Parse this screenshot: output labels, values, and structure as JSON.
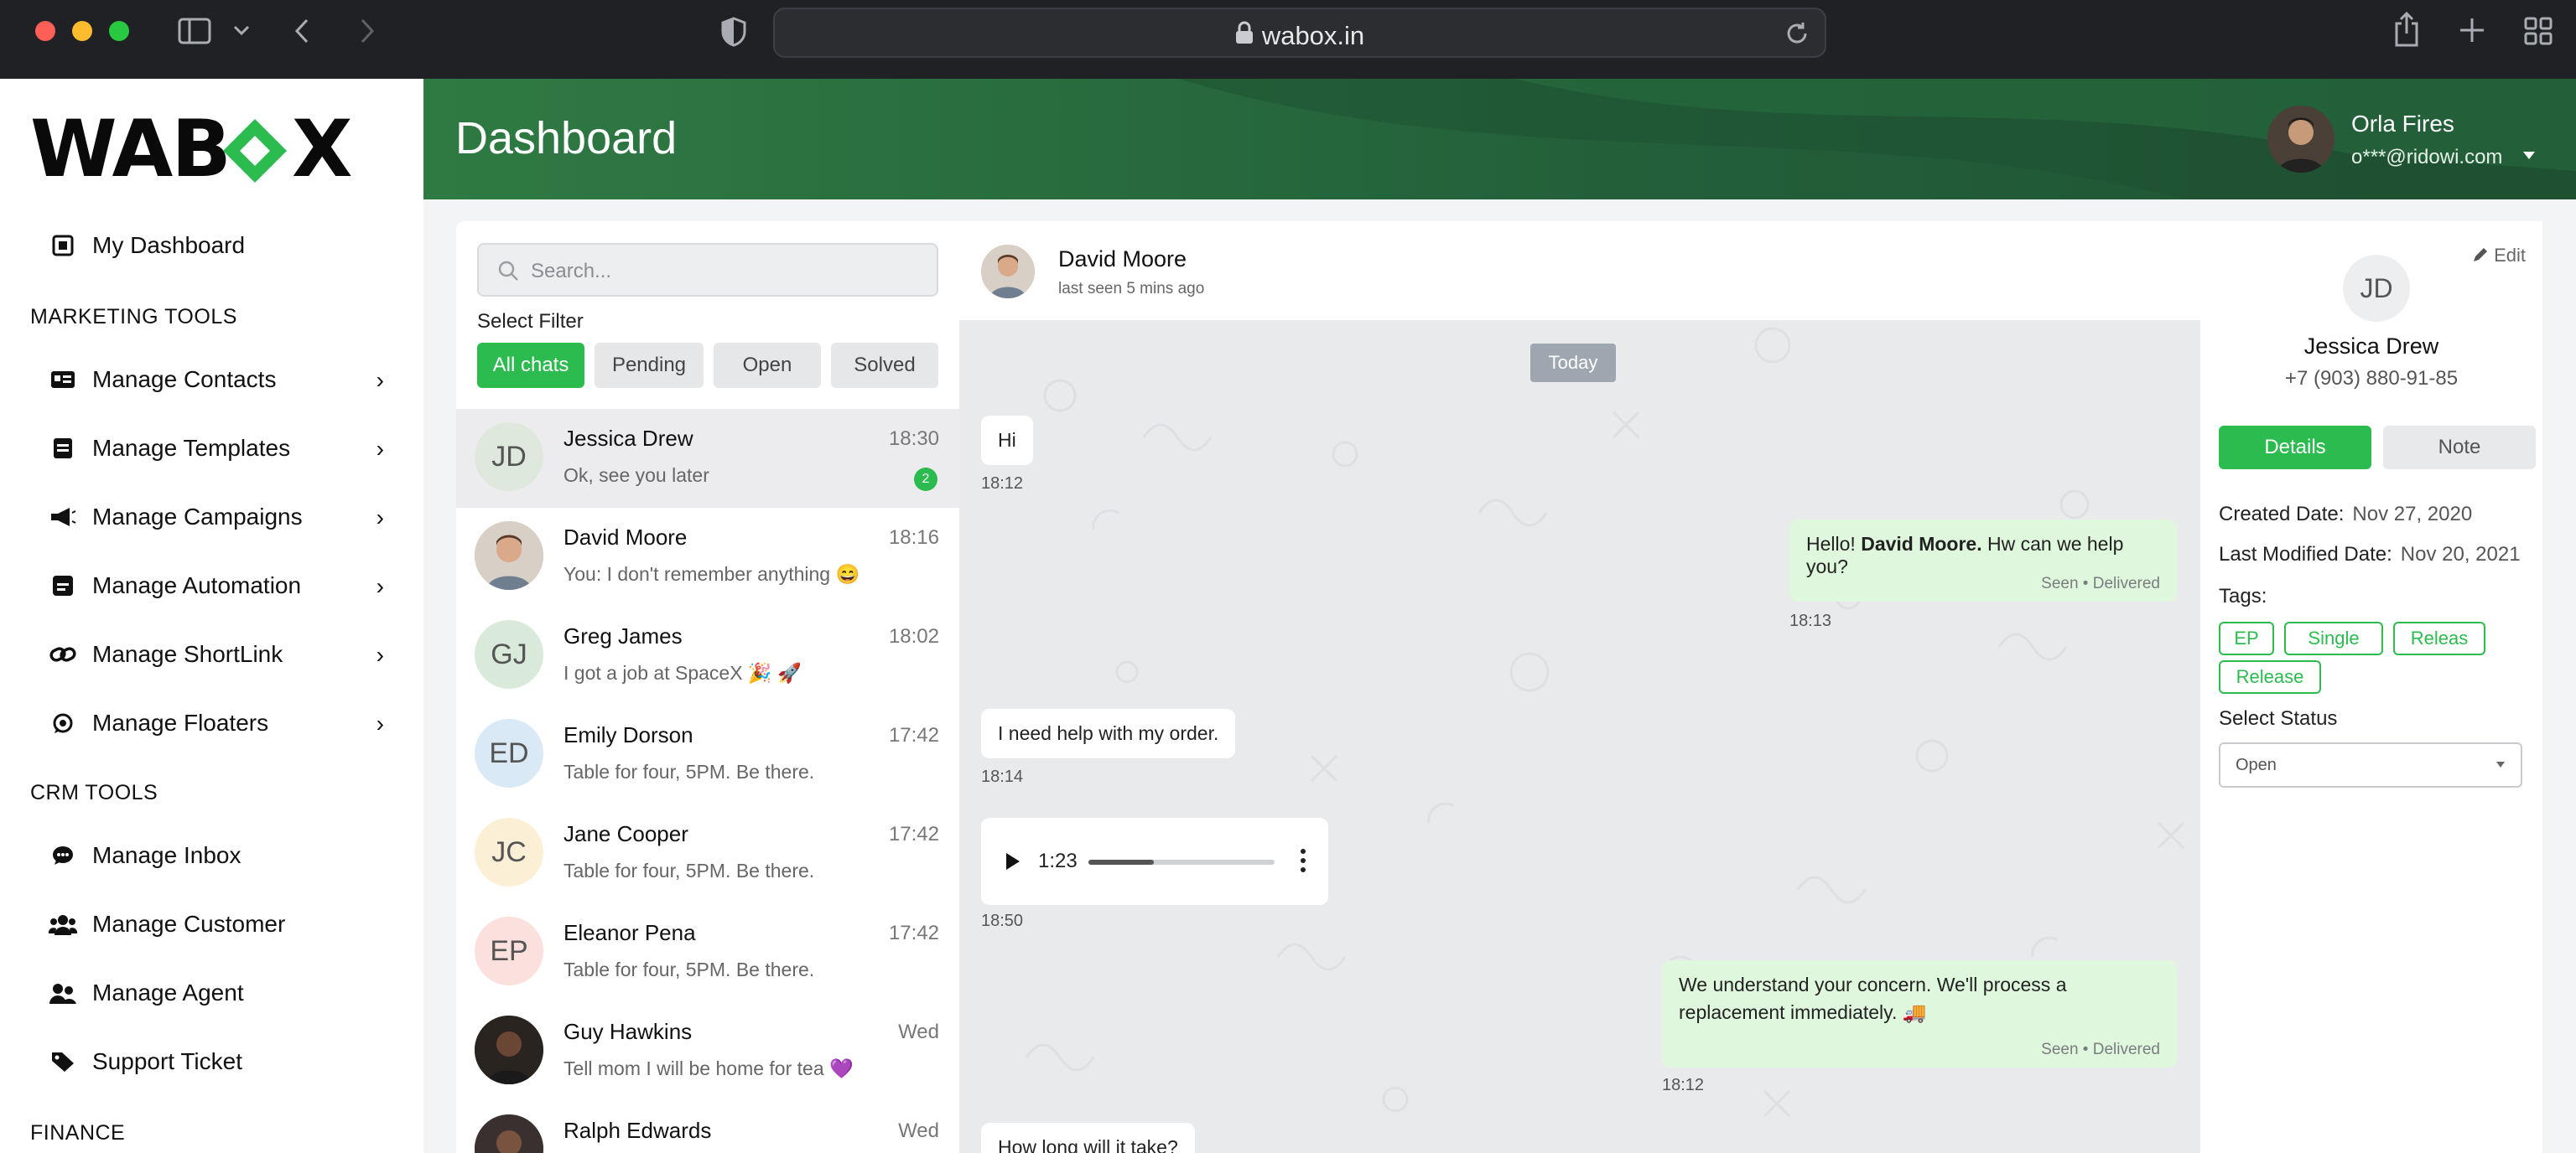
{
  "browser": {
    "url": "wabox.in"
  },
  "sidebar": {
    "logo_left": "WAB",
    "logo_right": "X",
    "dashboard_label": "My Dashboard",
    "sections": {
      "marketing": "MARKETING TOOLS",
      "crm": "CRM TOOLS",
      "finance": "FINANCE"
    },
    "marketing_items": [
      {
        "label": "Manage Contacts"
      },
      {
        "label": "Manage Templates"
      },
      {
        "label": "Manage Campaigns"
      },
      {
        "label": "Manage Automation"
      },
      {
        "label": "Manage ShortLink"
      },
      {
        "label": "Manage Floaters"
      }
    ],
    "crm_items": [
      {
        "label": "Manage Inbox"
      },
      {
        "label": "Manage Customer"
      },
      {
        "label": "Manage Agent"
      },
      {
        "label": "Support Ticket"
      }
    ]
  },
  "header": {
    "title": "Dashboard",
    "user_name": "Orla Fires",
    "user_email": "o***@ridowi.com"
  },
  "chat_list": {
    "search_placeholder": "Search...",
    "filter_label": "Select Filter",
    "filters": [
      "All chats",
      "Pending",
      "Open",
      "Solved"
    ],
    "active_filter": "All chats",
    "chats": [
      {
        "initials": "JD",
        "name": "Jessica Drew",
        "message": "Ok, see you later",
        "time": "18:30",
        "unread": "2",
        "avatar_color": "#dfe8dc"
      },
      {
        "initials": "",
        "name": "David Moore",
        "message": "You: I don't remember anything 😄",
        "time": "18:16",
        "avatar_color": "#c9b8a8"
      },
      {
        "initials": "GJ",
        "name": "Greg James",
        "message": "I got a job at SpaceX 🎉 🚀",
        "time": "18:02",
        "avatar_color": "#d9eadb"
      },
      {
        "initials": "ED",
        "name": "Emily Dorson",
        "message": "Table for four, 5PM. Be there.",
        "time": "17:42",
        "avatar_color": "#d9e9f5"
      },
      {
        "initials": "JC",
        "name": "Jane Cooper",
        "message": "Table for four, 5PM. Be there.",
        "time": "17:42",
        "avatar_color": "#fbefd6"
      },
      {
        "initials": "EP",
        "name": "Eleanor Pena",
        "message": "Table for four, 5PM. Be there.",
        "time": "17:42",
        "avatar_color": "#fbe0de"
      },
      {
        "initials": "",
        "name": "Guy Hawkins",
        "message": "Tell mom I will be home for tea 💜",
        "time": "Wed",
        "avatar_color": "#3a2c26"
      },
      {
        "initials": "",
        "name": "Ralph Edwards",
        "message": "",
        "time": "Wed",
        "avatar_color": "#4a3a30"
      }
    ]
  },
  "conversation": {
    "contact_name": "David Moore",
    "contact_status": "last seen 5 mins ago",
    "date_chip": "Today",
    "messages": [
      {
        "text": "Hi",
        "time": "18:12"
      },
      {
        "text_pre": "Hello! ",
        "text_bold": "David Moore.",
        "text_post": " Hw can we help you?",
        "status": "Seen • Delivered",
        "time": "18:13"
      },
      {
        "text": "I need help with my order.",
        "time": "18:14"
      },
      {
        "audio_duration": "1:23",
        "audio_progress": 0.35,
        "time": "18:50"
      },
      {
        "text_line1": "We understand your concern. We'll process a",
        "text_line2": "replacement immediately. 🚚",
        "status": "Seen • Delivered",
        "time": "18:12"
      },
      {
        "text": "How long will it take?"
      }
    ]
  },
  "details": {
    "edit_label": "Edit",
    "initials": "JD",
    "name": "Jessica Drew",
    "phone": "+7 (903) 880-91-85",
    "tabs": [
      "Details",
      "Note"
    ],
    "active_tab": "Details",
    "created_label": "Created Date:",
    "created_value": "Nov 27, 2020",
    "modified_label": "Last Modified Date:",
    "modified_value": "Nov 20, 2021",
    "tags_label": "Tags:",
    "tags": [
      "EP",
      "Single",
      "Releas",
      "Release"
    ],
    "status_label": "Select Status",
    "status_value": "Open"
  },
  "colors": {
    "accent_green": "#2bbb4f",
    "header_green": "#23603a",
    "bubble_out": "#dff7dc"
  }
}
